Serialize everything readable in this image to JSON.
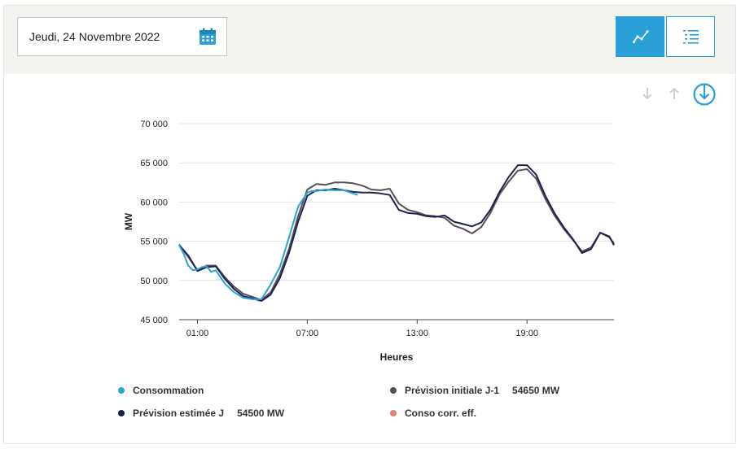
{
  "date_picker": {
    "value": "Jeudi, 24 Novembre 2022",
    "icon": "calendar-icon"
  },
  "view_toggle": {
    "chart_icon": "line-chart-icon",
    "table_icon": "list-icon",
    "active": "chart"
  },
  "actions": {
    "down_icon": "arrow-down-icon",
    "up_icon": "arrow-up-icon",
    "download_icon": "download-icon"
  },
  "colors": {
    "accent": "#2a9fd8",
    "consommation": "#2aa3d6",
    "prevision_j1": "#555055",
    "prevision_j": "#1a2350",
    "conso_corr": "#e87d6a"
  },
  "chart_data": {
    "type": "line",
    "xlabel": "Heures",
    "ylabel": "MW",
    "xlim": [
      0,
      23.75
    ],
    "ylim": [
      45000,
      70000
    ],
    "yticks": [
      45000,
      50000,
      55000,
      60000,
      65000,
      70000
    ],
    "ytick_labels": [
      "45 000",
      "50 000",
      "55 000",
      "60 000",
      "65 000",
      "70 000"
    ],
    "xticks": [
      1,
      7,
      13,
      19
    ],
    "xtick_labels": [
      "01:00",
      "07:00",
      "13:00",
      "19:00"
    ],
    "grid": true,
    "legend": [
      {
        "label": "Consommation",
        "value": "",
        "color": "#2aa3d6"
      },
      {
        "label": "Prévision initiale J-1",
        "value": "54650 MW",
        "color": "#555055"
      },
      {
        "label": "Prévision estimée J",
        "value": "54500 MW",
        "color": "#1a2350"
      },
      {
        "label": "Conso corr. eff.",
        "value": "",
        "color": "#e87d6a"
      }
    ],
    "series": [
      {
        "name": "Consommation",
        "color": "#2aa3d6",
        "x": [
          0,
          0.25,
          0.5,
          0.75,
          1,
          1.25,
          1.5,
          1.75,
          2,
          2.5,
          3,
          3.5,
          4,
          4.5,
          5,
          5.5,
          6,
          6.5,
          7,
          7.25,
          7.5,
          8,
          8.5,
          9,
          9.5,
          9.75
        ],
        "y": [
          54500,
          53400,
          51900,
          51300,
          51400,
          51700,
          51800,
          51100,
          51300,
          49600,
          48500,
          47800,
          47600,
          47600,
          49500,
          51700,
          55500,
          59400,
          61200,
          61400,
          61400,
          61600,
          61500,
          61500,
          61100,
          60900
        ]
      },
      {
        "name": "Prévision initiale J-1",
        "color": "#555055",
        "x": [
          0,
          0.5,
          1,
          1.5,
          2,
          2.5,
          3,
          3.5,
          4,
          4.5,
          5,
          5.5,
          6,
          6.5,
          7,
          7.5,
          8,
          8.5,
          9,
          9.5,
          10,
          10.5,
          11,
          11.5,
          12,
          12.5,
          13,
          13.5,
          14,
          14.5,
          15,
          15.5,
          16,
          16.5,
          17,
          17.5,
          18,
          18.5,
          19,
          19.5,
          20,
          20.5,
          21,
          21.5,
          22,
          22.5,
          23,
          23.5,
          23.75
        ],
        "y": [
          54600,
          53000,
          51300,
          51900,
          51900,
          50400,
          49200,
          48300,
          47900,
          47500,
          48500,
          50800,
          54000,
          58200,
          61600,
          62300,
          62200,
          62500,
          62500,
          62400,
          62100,
          61600,
          61500,
          61700,
          59800,
          59000,
          58700,
          58300,
          58200,
          58000,
          57000,
          56600,
          56000,
          56800,
          58600,
          61000,
          62600,
          64000,
          64200,
          63000,
          60400,
          58300,
          56600,
          55200,
          53700,
          54200,
          56100,
          55500,
          54700
        ]
      },
      {
        "name": "Prévision estimée J",
        "color": "#1a2350",
        "x": [
          0,
          0.5,
          1,
          1.5,
          2,
          2.5,
          3,
          3.5,
          4,
          4.5,
          5,
          5.5,
          6,
          6.5,
          7,
          7.5,
          8,
          8.5,
          9,
          9.5,
          10,
          10.5,
          11,
          11.5,
          12,
          12.5,
          13,
          13.5,
          14,
          14.5,
          15,
          15.5,
          16,
          16.5,
          17,
          17.5,
          18,
          18.5,
          19,
          19.5,
          20,
          20.5,
          21,
          21.5,
          22,
          22.5,
          23,
          23.5,
          23.75
        ],
        "y": [
          54500,
          53200,
          51200,
          51700,
          51800,
          50200,
          48900,
          48000,
          47700,
          47400,
          48200,
          50300,
          53500,
          57500,
          60800,
          61500,
          61500,
          61700,
          61500,
          61300,
          61200,
          61200,
          61100,
          60900,
          59000,
          58600,
          58500,
          58200,
          58100,
          58300,
          57500,
          57200,
          56900,
          57400,
          59000,
          61300,
          63200,
          64700,
          64700,
          63500,
          60800,
          58600,
          56800,
          55300,
          53500,
          54000,
          56100,
          55600,
          54500
        ]
      }
    ]
  }
}
